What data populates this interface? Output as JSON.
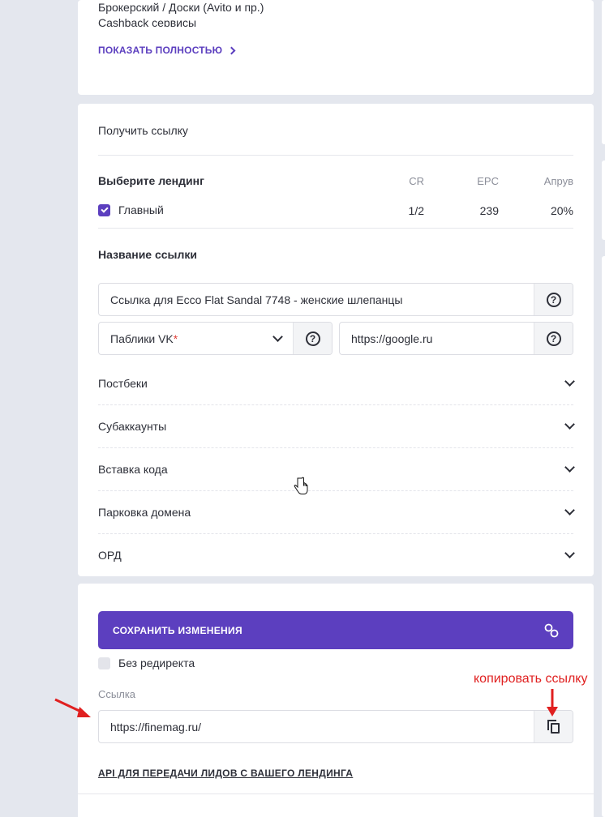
{
  "offer_card": {
    "lines": [
      "Брокерский / Доски (Avito и пр.)",
      "Cashback сервисы"
    ],
    "show_more_label": "ПОКАЗАТЬ ПОЛНОСТЬЮ"
  },
  "link_card": {
    "title": "Получить ссылку",
    "landing_section": {
      "label": "Выберите лендинг",
      "columns": [
        "CR",
        "EPC",
        "Апрув"
      ],
      "rows": [
        {
          "name": "Главный",
          "checked": true,
          "cr": "1/2",
          "epc": "239",
          "approve": "20%"
        }
      ]
    },
    "link_name_label": "Название ссылки",
    "link_name_value": "Ссылка для Ecco Flat Sandal 7748 - женские шлепанцы",
    "traffic_source_value": "Паблики VK",
    "traffic_source_required_mark": "*",
    "url_value": "https://google.ru",
    "help_glyph": "?",
    "accordions": [
      "Постбеки",
      "Субаккаунты",
      "Вставка кода",
      "Парковка домена",
      "ОРД"
    ]
  },
  "save_card": {
    "save_button_label": "СОХРАНИТЬ ИЗМЕНЕНИЯ",
    "no_redirect_label": "Без редиректа",
    "no_redirect_checked": false,
    "link_label": "Ссылка",
    "link_value": "https://finemag.ru/",
    "api_link_label": "API ДЛЯ ПЕРЕДАЧИ ЛИДОВ С ВАШЕГО ЛЕНДИНГА"
  },
  "annotation": {
    "copy_hint": "копировать ссылку"
  },
  "colors": {
    "accent": "#5c3fbf",
    "background": "#e4e7ee",
    "annotation_red": "#e02020"
  }
}
